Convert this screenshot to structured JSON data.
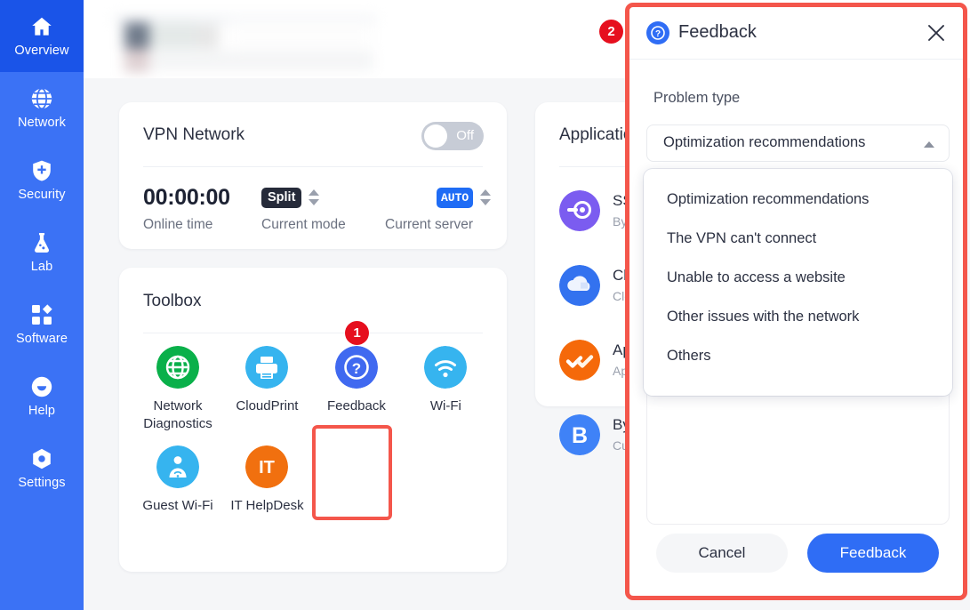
{
  "sidebar": {
    "items": [
      {
        "label": "Overview",
        "icon": "home-icon",
        "active": true
      },
      {
        "label": "Network",
        "icon": "globe-icon",
        "active": false
      },
      {
        "label": "Security",
        "icon": "shield-plus-icon",
        "active": false
      },
      {
        "label": "Lab",
        "icon": "flask-icon",
        "active": false
      },
      {
        "label": "Software",
        "icon": "apps-grid-icon",
        "active": false
      },
      {
        "label": "Help",
        "icon": "help-face-icon",
        "active": false
      },
      {
        "label": "Settings",
        "icon": "gear-icon",
        "active": false
      }
    ],
    "bg_color": "#3b72f5",
    "active_color": "#1a54e8"
  },
  "vpn_card": {
    "title": "VPN Network",
    "toggle": {
      "state_label": "Off",
      "on": false
    },
    "stats": [
      {
        "value": "00:00:00",
        "label": "Online time",
        "type": "time"
      },
      {
        "value": "Split",
        "label": "Current mode",
        "type": "chip-dark"
      },
      {
        "value": "AUTO",
        "label": "Current server",
        "type": "chip-blue"
      }
    ]
  },
  "toolbox_card": {
    "title": "Toolbox",
    "tools": [
      {
        "label": "Network Diagnostics",
        "icon": "globe-icon",
        "color": "#0ab04a"
      },
      {
        "label": "CloudPrint",
        "icon": "printer-icon",
        "color": "#36b4ef"
      },
      {
        "label": "Feedback",
        "icon": "question-circle-icon",
        "color": "#4069f0",
        "highlighted": true
      },
      {
        "label": "Wi-Fi",
        "icon": "wifi-icon",
        "color": "#36b4ef"
      },
      {
        "label": "Guest Wi-Fi",
        "icon": "guest-wifi-icon",
        "color": "#36b4ef"
      },
      {
        "label": "IT HelpDesk",
        "icon": "it-helpdesk-icon",
        "color": "#f1700f"
      }
    ]
  },
  "application_card": {
    "title": "Application",
    "items": [
      {
        "name": "SSO",
        "sub": "Byte",
        "icon": "sso-key-icon",
        "color": "#7b5cf0"
      },
      {
        "name": "Clo",
        "sub": "Clo",
        "icon": "cloud-icon",
        "color": "#3372ef"
      },
      {
        "name": "App",
        "sub": "App",
        "icon": "check-marks-icon",
        "color": "#f5690a"
      },
      {
        "name": "Byt",
        "sub": "Cul",
        "icon": "letter-b-icon",
        "color": "#3f82f7"
      }
    ]
  },
  "annotations": [
    {
      "number": "1",
      "target": "feedback-tool"
    },
    {
      "number": "2",
      "target": "feedback-modal"
    }
  ],
  "modal": {
    "title": "Feedback",
    "icon": "question-circle-icon",
    "close_icon": "close-icon",
    "field_label": "Problem type",
    "select": {
      "value": "Optimization recommendations",
      "expanded": true,
      "options": [
        "Optimization recommendations",
        "The VPN can't connect",
        "Unable to access a website",
        "Other issues with the network",
        "Others"
      ]
    },
    "description": {
      "value": "",
      "placeholder": ""
    },
    "buttons": {
      "cancel": "Cancel",
      "submit": "Feedback"
    },
    "accent_color": "#2f6df5",
    "highlight_color": "#f4564b"
  }
}
